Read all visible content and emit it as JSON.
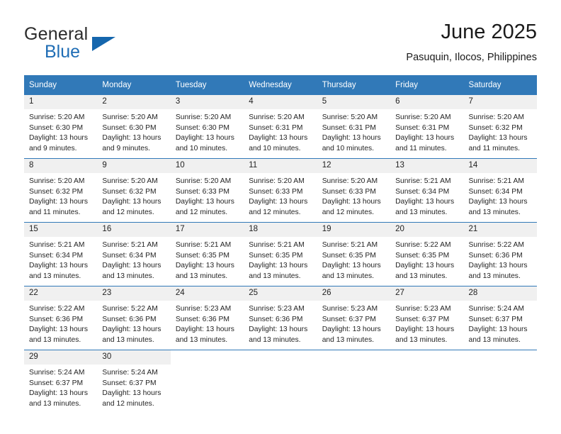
{
  "brand": {
    "line1": "General",
    "line2": "Blue",
    "triangle_color": "#1566ad",
    "blue_color": "#1f6db5"
  },
  "header": {
    "title": "June 2025",
    "location": "Pasuquin, Ilocos, Philippines"
  },
  "theme": {
    "header_blue": "#3179b8",
    "daynum_bg": "#f0f0f0"
  },
  "weekday_headers": [
    "Sunday",
    "Monday",
    "Tuesday",
    "Wednesday",
    "Thursday",
    "Friday",
    "Saturday"
  ],
  "weeks": [
    [
      {
        "day": "1",
        "sunrise": "Sunrise: 5:20 AM",
        "sunset": "Sunset: 6:30 PM",
        "daylight1": "Daylight: 13 hours",
        "daylight2": "and 9 minutes."
      },
      {
        "day": "2",
        "sunrise": "Sunrise: 5:20 AM",
        "sunset": "Sunset: 6:30 PM",
        "daylight1": "Daylight: 13 hours",
        "daylight2": "and 9 minutes."
      },
      {
        "day": "3",
        "sunrise": "Sunrise: 5:20 AM",
        "sunset": "Sunset: 6:30 PM",
        "daylight1": "Daylight: 13 hours",
        "daylight2": "and 10 minutes."
      },
      {
        "day": "4",
        "sunrise": "Sunrise: 5:20 AM",
        "sunset": "Sunset: 6:31 PM",
        "daylight1": "Daylight: 13 hours",
        "daylight2": "and 10 minutes."
      },
      {
        "day": "5",
        "sunrise": "Sunrise: 5:20 AM",
        "sunset": "Sunset: 6:31 PM",
        "daylight1": "Daylight: 13 hours",
        "daylight2": "and 10 minutes."
      },
      {
        "day": "6",
        "sunrise": "Sunrise: 5:20 AM",
        "sunset": "Sunset: 6:31 PM",
        "daylight1": "Daylight: 13 hours",
        "daylight2": "and 11 minutes."
      },
      {
        "day": "7",
        "sunrise": "Sunrise: 5:20 AM",
        "sunset": "Sunset: 6:32 PM",
        "daylight1": "Daylight: 13 hours",
        "daylight2": "and 11 minutes."
      }
    ],
    [
      {
        "day": "8",
        "sunrise": "Sunrise: 5:20 AM",
        "sunset": "Sunset: 6:32 PM",
        "daylight1": "Daylight: 13 hours",
        "daylight2": "and 11 minutes."
      },
      {
        "day": "9",
        "sunrise": "Sunrise: 5:20 AM",
        "sunset": "Sunset: 6:32 PM",
        "daylight1": "Daylight: 13 hours",
        "daylight2": "and 12 minutes."
      },
      {
        "day": "10",
        "sunrise": "Sunrise: 5:20 AM",
        "sunset": "Sunset: 6:33 PM",
        "daylight1": "Daylight: 13 hours",
        "daylight2": "and 12 minutes."
      },
      {
        "day": "11",
        "sunrise": "Sunrise: 5:20 AM",
        "sunset": "Sunset: 6:33 PM",
        "daylight1": "Daylight: 13 hours",
        "daylight2": "and 12 minutes."
      },
      {
        "day": "12",
        "sunrise": "Sunrise: 5:20 AM",
        "sunset": "Sunset: 6:33 PM",
        "daylight1": "Daylight: 13 hours",
        "daylight2": "and 12 minutes."
      },
      {
        "day": "13",
        "sunrise": "Sunrise: 5:21 AM",
        "sunset": "Sunset: 6:34 PM",
        "daylight1": "Daylight: 13 hours",
        "daylight2": "and 13 minutes."
      },
      {
        "day": "14",
        "sunrise": "Sunrise: 5:21 AM",
        "sunset": "Sunset: 6:34 PM",
        "daylight1": "Daylight: 13 hours",
        "daylight2": "and 13 minutes."
      }
    ],
    [
      {
        "day": "15",
        "sunrise": "Sunrise: 5:21 AM",
        "sunset": "Sunset: 6:34 PM",
        "daylight1": "Daylight: 13 hours",
        "daylight2": "and 13 minutes."
      },
      {
        "day": "16",
        "sunrise": "Sunrise: 5:21 AM",
        "sunset": "Sunset: 6:34 PM",
        "daylight1": "Daylight: 13 hours",
        "daylight2": "and 13 minutes."
      },
      {
        "day": "17",
        "sunrise": "Sunrise: 5:21 AM",
        "sunset": "Sunset: 6:35 PM",
        "daylight1": "Daylight: 13 hours",
        "daylight2": "and 13 minutes."
      },
      {
        "day": "18",
        "sunrise": "Sunrise: 5:21 AM",
        "sunset": "Sunset: 6:35 PM",
        "daylight1": "Daylight: 13 hours",
        "daylight2": "and 13 minutes."
      },
      {
        "day": "19",
        "sunrise": "Sunrise: 5:21 AM",
        "sunset": "Sunset: 6:35 PM",
        "daylight1": "Daylight: 13 hours",
        "daylight2": "and 13 minutes."
      },
      {
        "day": "20",
        "sunrise": "Sunrise: 5:22 AM",
        "sunset": "Sunset: 6:35 PM",
        "daylight1": "Daylight: 13 hours",
        "daylight2": "and 13 minutes."
      },
      {
        "day": "21",
        "sunrise": "Sunrise: 5:22 AM",
        "sunset": "Sunset: 6:36 PM",
        "daylight1": "Daylight: 13 hours",
        "daylight2": "and 13 minutes."
      }
    ],
    [
      {
        "day": "22",
        "sunrise": "Sunrise: 5:22 AM",
        "sunset": "Sunset: 6:36 PM",
        "daylight1": "Daylight: 13 hours",
        "daylight2": "and 13 minutes."
      },
      {
        "day": "23",
        "sunrise": "Sunrise: 5:22 AM",
        "sunset": "Sunset: 6:36 PM",
        "daylight1": "Daylight: 13 hours",
        "daylight2": "and 13 minutes."
      },
      {
        "day": "24",
        "sunrise": "Sunrise: 5:23 AM",
        "sunset": "Sunset: 6:36 PM",
        "daylight1": "Daylight: 13 hours",
        "daylight2": "and 13 minutes."
      },
      {
        "day": "25",
        "sunrise": "Sunrise: 5:23 AM",
        "sunset": "Sunset: 6:36 PM",
        "daylight1": "Daylight: 13 hours",
        "daylight2": "and 13 minutes."
      },
      {
        "day": "26",
        "sunrise": "Sunrise: 5:23 AM",
        "sunset": "Sunset: 6:37 PM",
        "daylight1": "Daylight: 13 hours",
        "daylight2": "and 13 minutes."
      },
      {
        "day": "27",
        "sunrise": "Sunrise: 5:23 AM",
        "sunset": "Sunset: 6:37 PM",
        "daylight1": "Daylight: 13 hours",
        "daylight2": "and 13 minutes."
      },
      {
        "day": "28",
        "sunrise": "Sunrise: 5:24 AM",
        "sunset": "Sunset: 6:37 PM",
        "daylight1": "Daylight: 13 hours",
        "daylight2": "and 13 minutes."
      }
    ],
    [
      {
        "day": "29",
        "sunrise": "Sunrise: 5:24 AM",
        "sunset": "Sunset: 6:37 PM",
        "daylight1": "Daylight: 13 hours",
        "daylight2": "and 13 minutes."
      },
      {
        "day": "30",
        "sunrise": "Sunrise: 5:24 AM",
        "sunset": "Sunset: 6:37 PM",
        "daylight1": "Daylight: 13 hours",
        "daylight2": "and 12 minutes."
      },
      null,
      null,
      null,
      null,
      null
    ]
  ]
}
